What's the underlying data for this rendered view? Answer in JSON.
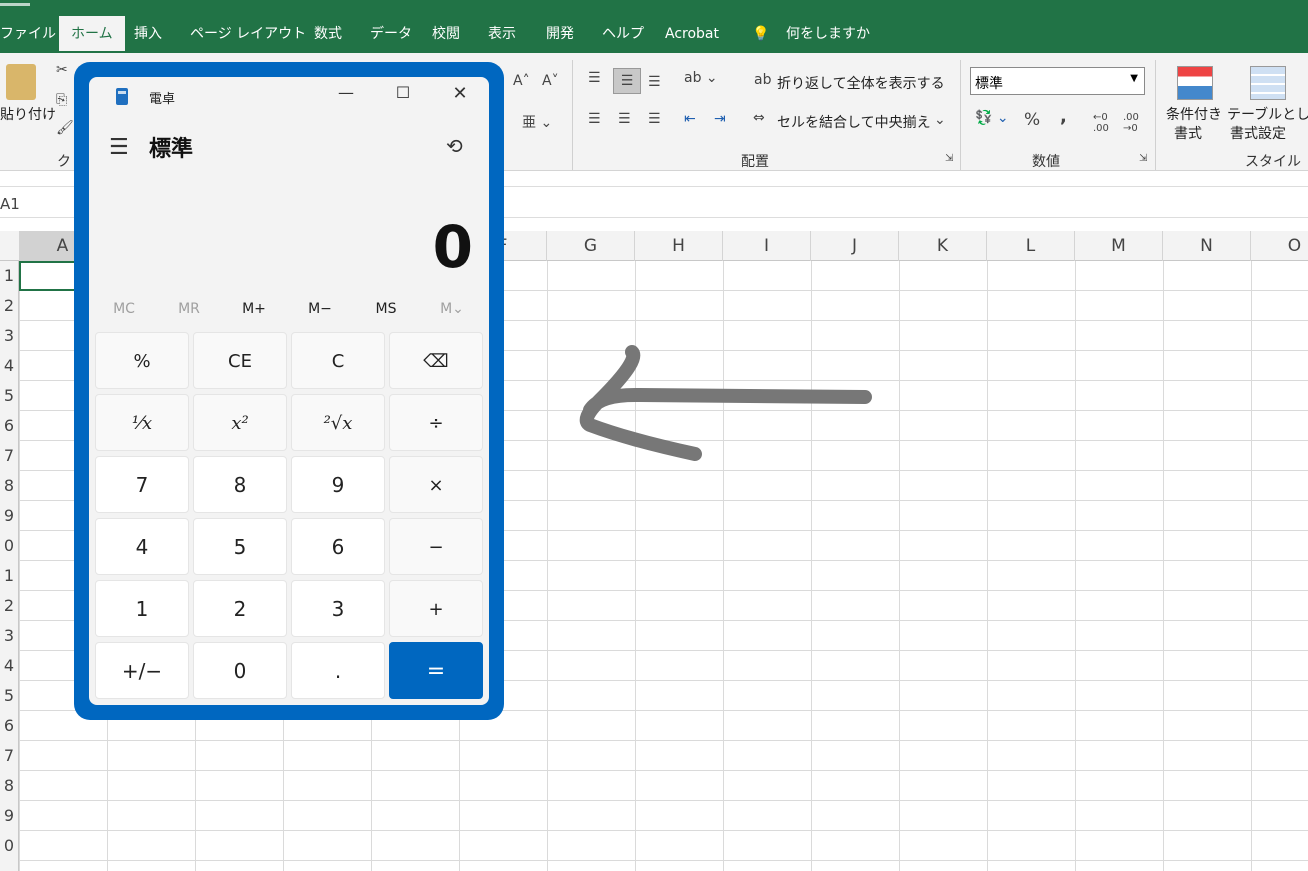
{
  "excel": {
    "tabs": [
      {
        "label": "ファイル"
      },
      {
        "label": "ホーム"
      },
      {
        "label": "挿入"
      },
      {
        "label": "ページ レイアウト"
      },
      {
        "label": "数式"
      },
      {
        "label": "データ"
      },
      {
        "label": "校閲"
      },
      {
        "label": "表示"
      },
      {
        "label": "開発"
      },
      {
        "label": "ヘルプ"
      },
      {
        "label": "Acrobat"
      },
      {
        "label": "何をしますか"
      }
    ],
    "ribbon": {
      "paste_label": "貼り付け",
      "clipboard_group": "クリ",
      "wrap_text": "折り返して全体を表示する",
      "merge_center": "セルを結合して中央揃え",
      "alignment_group": "配置",
      "number_format": "標準",
      "number_group": "数値",
      "percent": "%",
      "comma": ",",
      "conditional_format": "条件付き",
      "conditional_format2": "書式",
      "table_format": "テーブルとして",
      "table_format2": "書式設定",
      "styles_group": "スタイル"
    },
    "name_box": "A1",
    "columns": [
      "A",
      "F",
      "G",
      "H",
      "I",
      "J",
      "K",
      "L",
      "M",
      "N",
      "O"
    ],
    "rows": [
      "1",
      "2",
      "3",
      "4",
      "5",
      "6",
      "7",
      "8",
      "9",
      "0",
      "1",
      "2",
      "3",
      "4",
      "5",
      "6",
      "7",
      "8",
      "9",
      "0"
    ]
  },
  "calculator": {
    "title": "電卓",
    "mode": "標準",
    "display": "0",
    "memory": [
      {
        "label": "MC",
        "enabled": false
      },
      {
        "label": "MR",
        "enabled": false
      },
      {
        "label": "M+",
        "enabled": true
      },
      {
        "label": "M−",
        "enabled": true
      },
      {
        "label": "MS",
        "enabled": true
      },
      {
        "label": "M⌄",
        "enabled": false
      }
    ],
    "keys": [
      [
        "%",
        "CE",
        "C",
        "⌫"
      ],
      [
        "¹⁄x",
        "x²",
        "²√x",
        "÷"
      ],
      [
        "7",
        "8",
        "9",
        "×"
      ],
      [
        "4",
        "5",
        "6",
        "−"
      ],
      [
        "1",
        "2",
        "3",
        "+"
      ],
      [
        "+/−",
        "0",
        ".",
        "="
      ]
    ],
    "accent": "#0067c0"
  }
}
